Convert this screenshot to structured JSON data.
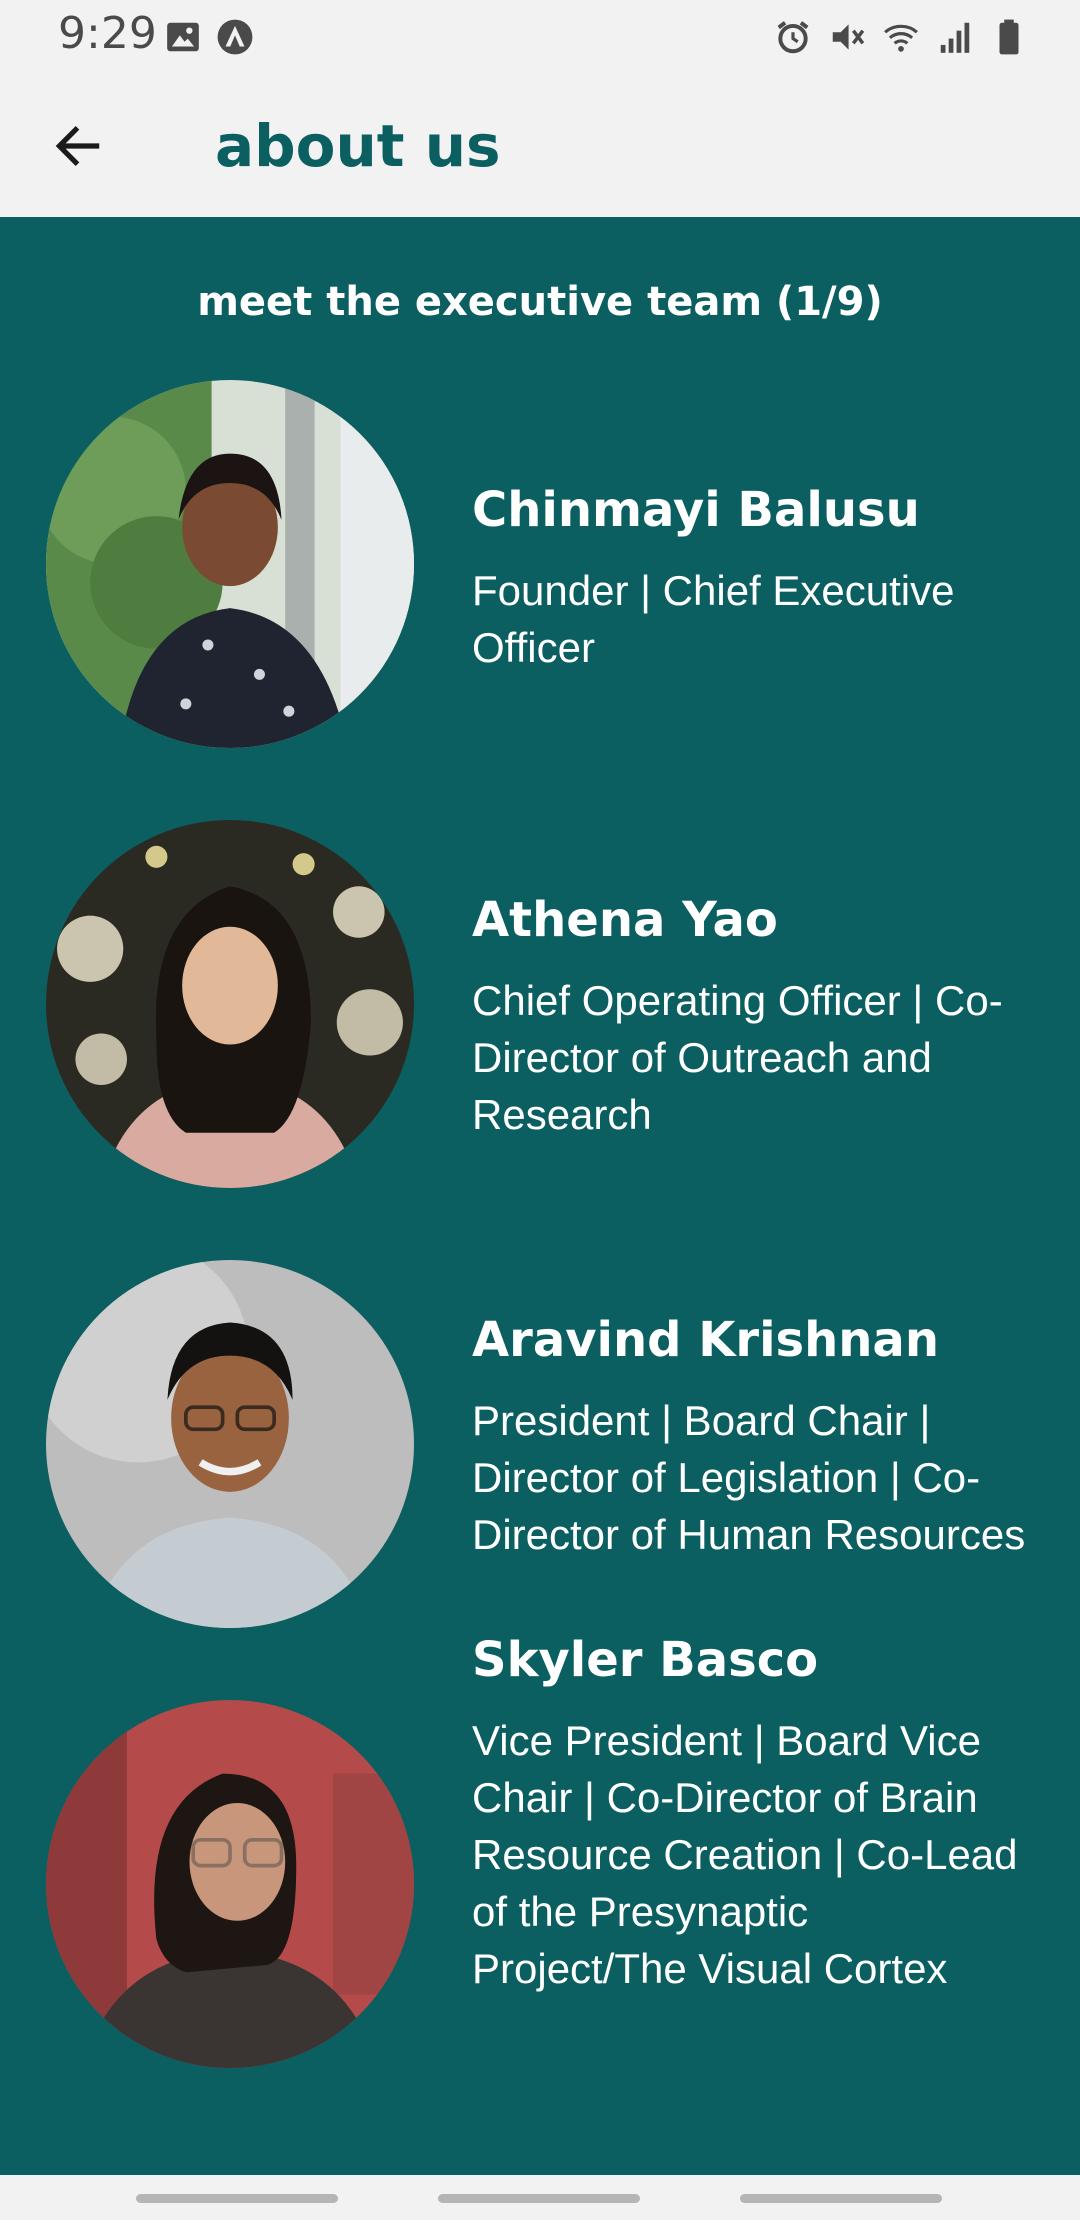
{
  "status_bar": {
    "time": "9:29",
    "left_icons": [
      "image-icon",
      "app-notification-icon"
    ],
    "right_icons": [
      "alarm-icon",
      "mute-icon",
      "wifi-icon",
      "signal-icon",
      "battery-icon"
    ]
  },
  "app_bar": {
    "back_icon": "arrow-left-icon",
    "title": "about us"
  },
  "content": {
    "heading": "meet the executive team (1/9)",
    "members": [
      {
        "name": "Chinmayi Balusu",
        "role": "Founder | Chief Executive Officer",
        "photo": "avatar-chinmayi"
      },
      {
        "name": "Athena Yao",
        "role": "Chief Operating Officer | Co-Director of Outreach and Research",
        "photo": "avatar-athena"
      },
      {
        "name": "Aravind Krishnan",
        "role": "President | Board Chair | Director of Legislation | Co-Director of Human Resources",
        "photo": "avatar-aravind"
      },
      {
        "name": "Skyler Basco",
        "role": "Vice President | Board Vice Chair | Co-Director of Brain Resource Creation | Co-Lead of the Presynaptic Project/The Visual Cortex",
        "photo": "avatar-skyler"
      }
    ]
  },
  "colors": {
    "primary": "#0b5f61",
    "background": "#f2f2f2",
    "text_on_primary": "#ffffff"
  }
}
